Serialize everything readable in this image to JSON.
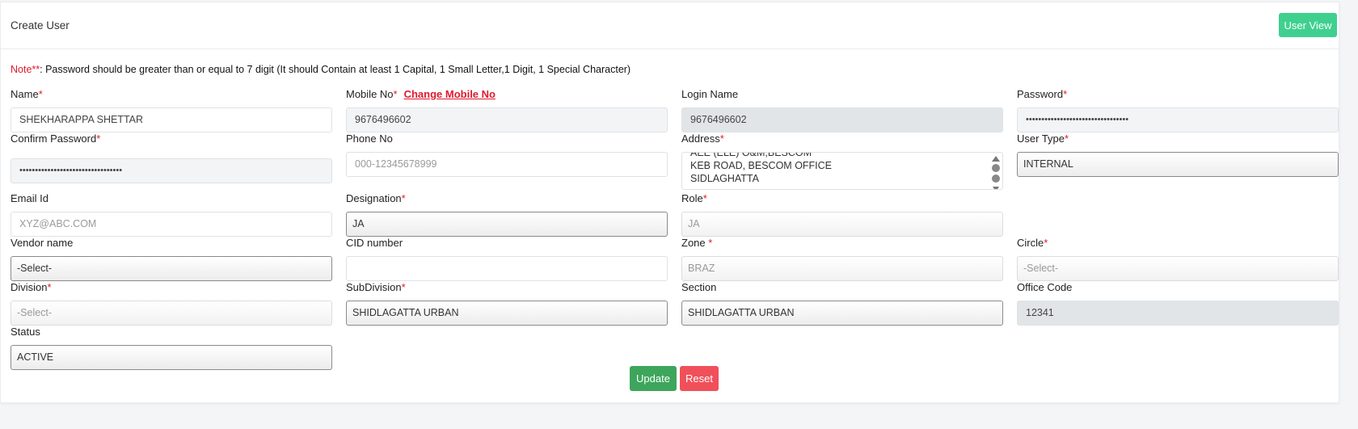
{
  "header": {
    "title": "Create User",
    "user_view_label": "User View"
  },
  "note": {
    "prefix": "Note**",
    "text": ": Password should be greater than or equal to 7 digit (It should Contain at least 1 Capital, 1 Small Letter,1 Digit, 1 Special Character)"
  },
  "fields": {
    "name": {
      "label": "Name",
      "value": "SHEKHARAPPA SHETTAR"
    },
    "mobile": {
      "label": "Mobile No",
      "value": "9676496602",
      "change_link": "Change Mobile No"
    },
    "login": {
      "label": "Login Name",
      "value": "9676496602"
    },
    "password": {
      "label": "Password",
      "value": "•••••••••••••••••••••••••••••••••"
    },
    "confirm": {
      "label": "Confirm Password",
      "value": "•••••••••••••••••••••••••••••••••"
    },
    "phone": {
      "label": "Phone No",
      "placeholder": "000-12345678999"
    },
    "address": {
      "label": "Address",
      "lines": [
        "AEE (ELE) O&M,BESCOM",
        "KEB ROAD, BESCOM OFFICE",
        "SIDLAGHATTA"
      ]
    },
    "user_type": {
      "label": "User Type",
      "value": "INTERNAL"
    },
    "email": {
      "label": "Email Id",
      "placeholder": "XYZ@ABC.COM"
    },
    "designation": {
      "label": "Designation",
      "value": "JA"
    },
    "role": {
      "label": "Role",
      "value": "JA"
    },
    "vendor": {
      "label": "Vendor name",
      "value": "-Select-"
    },
    "cid": {
      "label": "CID number",
      "value": ""
    },
    "zone": {
      "label": "Zone ",
      "value": "BRAZ"
    },
    "circle": {
      "label": "Circle",
      "value": "-Select-"
    },
    "division": {
      "label": "Division",
      "value": "-Select-"
    },
    "subdivision": {
      "label": "SubDivision",
      "value": "SHIDLAGATTA URBAN"
    },
    "section": {
      "label": "Section",
      "value": "SHIDLAGATTA URBAN"
    },
    "office_code": {
      "label": "Office Code",
      "value": "12341"
    },
    "status": {
      "label": "Status",
      "value": "ACTIVE"
    }
  },
  "required_mark": "*",
  "actions": {
    "update": "Update",
    "reset": "Reset"
  }
}
